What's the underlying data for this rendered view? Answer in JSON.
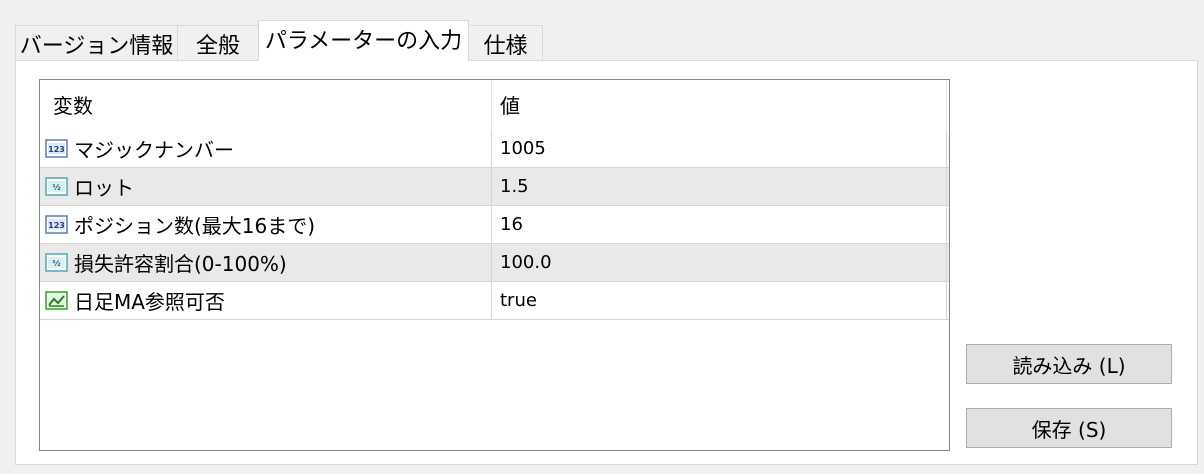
{
  "tabs": [
    {
      "label": "バージョン情報",
      "active": false
    },
    {
      "label": "全般",
      "active": false
    },
    {
      "label": "パラメーターの入力",
      "active": true
    },
    {
      "label": "仕様",
      "active": false
    }
  ],
  "table": {
    "columns": [
      "変数",
      "値"
    ],
    "rows": [
      {
        "icon": "integer-icon",
        "name": "マジックナンバー",
        "value": "1005"
      },
      {
        "icon": "double-icon",
        "name": "ロット",
        "value": "1.5"
      },
      {
        "icon": "integer-icon",
        "name": "ポジション数(最大16まで)",
        "value": "16"
      },
      {
        "icon": "double-icon",
        "name": "損失許容割合(0-100%)",
        "value": "100.0"
      },
      {
        "icon": "boolean-icon",
        "name": "日足MA参照可否",
        "value": "true"
      }
    ]
  },
  "buttons": {
    "load": "読み込み (L)",
    "save": "保存 (S)"
  },
  "colors": {
    "alt_row": "#e9e9e9",
    "button_bg": "#e1e1e1",
    "panel_bg": "#ffffff",
    "window_bg": "#f0f0f0"
  }
}
